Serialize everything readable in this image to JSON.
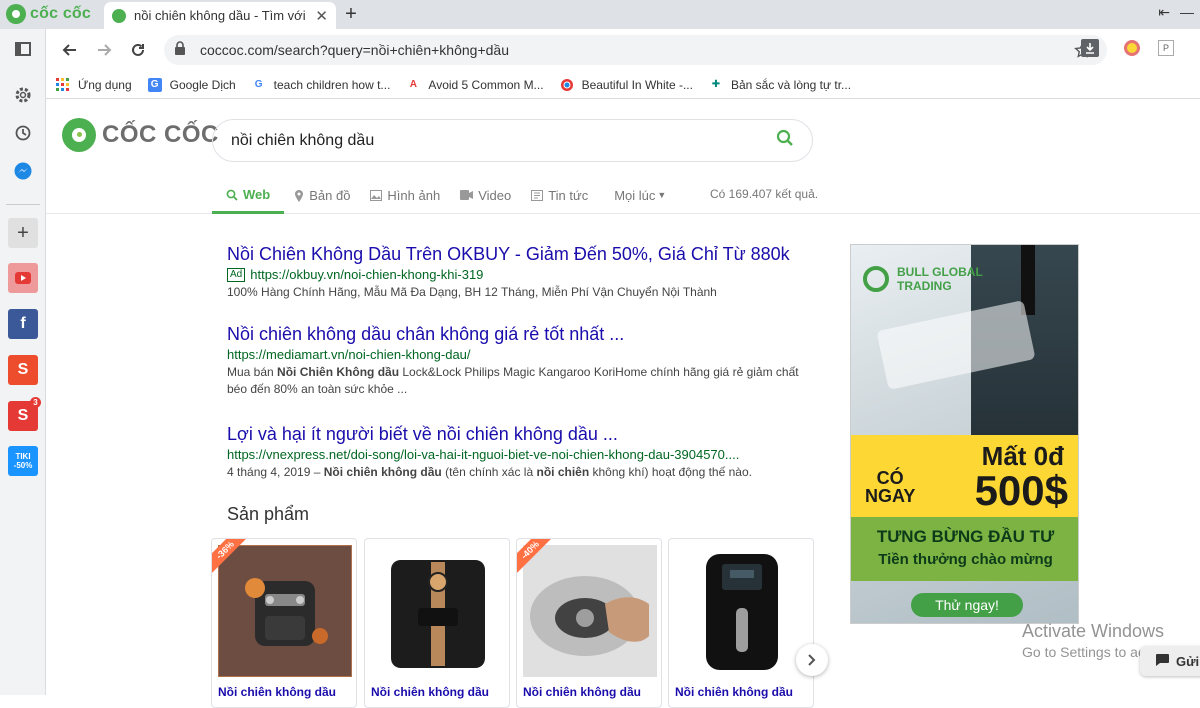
{
  "browser": {
    "brand_text": "cốc cốc",
    "tab_title": "nồi chiên không dầu - Tìm với Cốc Cốc",
    "url": "coccoc.com/search?query=nồi+chiên+không+dầu"
  },
  "bookmarks": [
    {
      "label": "Ứng dụng"
    },
    {
      "label": "Google Dịch"
    },
    {
      "label": "teach children how t..."
    },
    {
      "label": "Avoid 5 Common M..."
    },
    {
      "label": "Beautiful In White -..."
    },
    {
      "label": "Bản sắc và lòng tự tr..."
    }
  ],
  "sidebar": {
    "tiki_label": "TIKI -50%",
    "badge_count": "3"
  },
  "search": {
    "logo_text": "CỐC CỐC",
    "query": "nồi chiên không dầu",
    "tabs": [
      {
        "label": "Web"
      },
      {
        "label": "Bản đồ"
      },
      {
        "label": "Hình ảnh"
      },
      {
        "label": "Video"
      },
      {
        "label": "Tin tức"
      },
      {
        "label": "Mọi lúc"
      }
    ],
    "result_count": "Có 169.407 kết quả."
  },
  "results": [
    {
      "title": "Nồi Chiên Không Dầu Trên OKBUY - Giảm Đến 50%, Giá Chỉ Từ 880k",
      "ad_label": "Ad",
      "url": "https://okbuy.vn/noi-chien-khong-khi-319",
      "snippet": "100% Hàng Chính Hãng, Mẫu Mã Đa Dạng, BH 12 Tháng, Miễn Phí Vận Chuyển Nội Thành"
    },
    {
      "title": "Nồi chiên không dầu chân không giá rẻ tốt nhất ...",
      "url": "https://mediamart.vn/noi-chien-khong-dau/",
      "snippet_a": "Mua bán ",
      "snippet_b": "Nồi Chiên Không dầu",
      "snippet_c": " Lock&Lock Philips Magic Kangaroo KoriHome chính hãng giá rẻ giảm chất béo đến 80% an toàn sức khỏe ..."
    },
    {
      "title": "Lợi và hại ít người biết về nồi chiên không dầu ...",
      "url": "https://vnexpress.net/doi-song/loi-va-hai-it-nguoi-biet-ve-noi-chien-khong-dau-3904570....",
      "snippet_a": "4 tháng 4, 2019 – ",
      "snippet_b": "Nồi chiên không dầu",
      "snippet_c": " (tên chính xác là ",
      "snippet_d": "nồi chiên",
      "snippet_e": " không khí) hoạt động thế nào."
    }
  ],
  "products": {
    "heading": "Sản phẩm",
    "items": [
      {
        "label": "Nồi chiên không dầu",
        "ribbon": "-36%"
      },
      {
        "label": "Nồi chiên không dầu",
        "ribbon": ""
      },
      {
        "label": "Nồi chiên không dầu",
        "ribbon": "-40%"
      },
      {
        "label": "Nồi chiên không dầu",
        "ribbon": ""
      }
    ]
  },
  "ad": {
    "brand_line1": "BULL GLOBAL",
    "brand_line2": "TRADING",
    "headline1": "Mất 0đ",
    "headline2a": "CÓ",
    "headline2b": "NGAY",
    "amount": "500$",
    "line3": "TƯNG BỪNG ĐẦU TƯ",
    "line4": "Tiền thưởng chào mừng",
    "cta": "Thử ngay!"
  },
  "windows": {
    "activate_title": "Activate Windows",
    "activate_sub": "Go to Settings to activate Wi",
    "chat_label": "Gửi"
  },
  "colors": {
    "brand_green": "#4caf50",
    "link_blue": "#1a0dab",
    "url_green": "#006621"
  }
}
